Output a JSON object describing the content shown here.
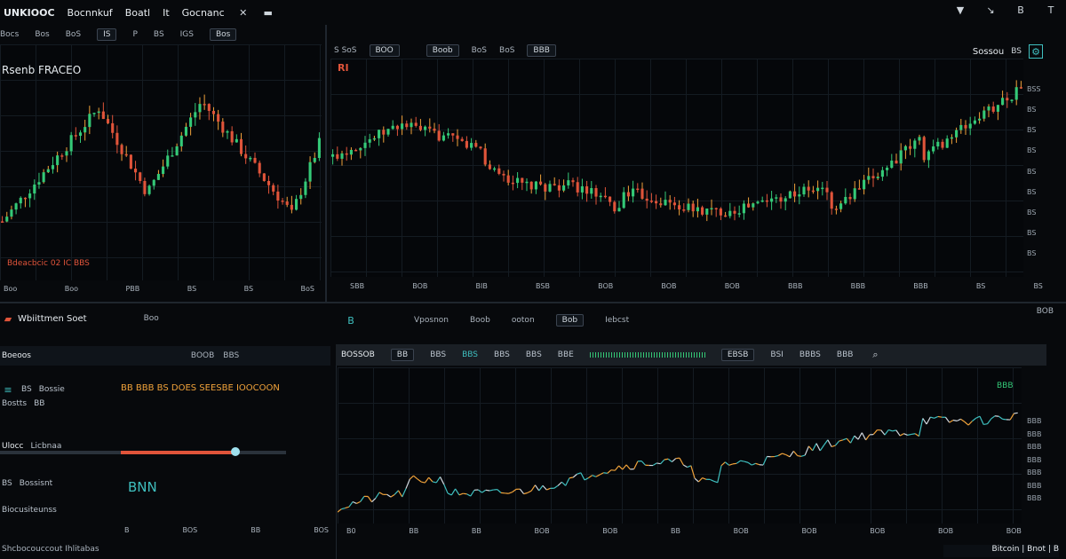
{
  "titlebar": {
    "app_title": "UNKIOOC",
    "menu_items": [
      "Bocnnkuf",
      "Boatl",
      "It",
      "Gocnanc"
    ],
    "window_icons": [
      "play-icon",
      "minimize-icon",
      "cursor-icon",
      "maximize-icon",
      "pin-icon"
    ]
  },
  "left_chart": {
    "toolbar": [
      "Bocs",
      "Bos",
      "BoS",
      "IS",
      "P",
      "BS",
      "IGS",
      "Bos"
    ],
    "title": "Rsenb FRACEO",
    "footer_label": "Bdeacbcic 02 IC BBS",
    "time_axis": [
      "Boo",
      "Boo",
      "PBB",
      "BS",
      "BS",
      "BoS"
    ]
  },
  "main_chart": {
    "toolbar": [
      "S SoS",
      "BOO",
      "Boob",
      "BoS",
      "BoS",
      "BBB"
    ],
    "symbol_badge": "RI",
    "right_label": "Sossou",
    "right_badge": "BS",
    "price_axis": [
      "BSS",
      "BS",
      "BS",
      "BS",
      "BS",
      "BS",
      "BS",
      "BS",
      "BS"
    ],
    "time_axis": [
      "SBB",
      "BOB",
      "BIB",
      "BSB",
      "BOB",
      "BOB",
      "BOB",
      "BBB",
      "BBB",
      "BBB",
      "BS",
      "BS"
    ]
  },
  "middle_bar": {
    "left_title": "Wbiittmen Soet",
    "left_btn": "Boo",
    "tabs": [
      "Vposnon",
      "Boob",
      "ooton",
      "Bob",
      "Iebcst"
    ],
    "right_value": "BOB"
  },
  "data_row": {
    "left": [
      "Boeoos",
      "BOOB",
      "BBS"
    ],
    "cells": [
      "BOSSOB",
      "BB",
      "BBS",
      "BBS",
      "BBS",
      "BBS",
      "BBE",
      "EBSB",
      "BSI",
      "BBBS",
      "BBB"
    ]
  },
  "side_panel": {
    "rows": [
      {
        "a": "BS",
        "b": "Bossie"
      },
      {
        "a": "Bostts",
        "b": "BB"
      },
      {
        "a": "Ulocc",
        "b": "Licbnaa"
      },
      {
        "a": "BS",
        "b": "Bossisnt"
      },
      {
        "a": "Biocusiteunss",
        "b": ""
      }
    ],
    "alert_text": "BB BBB BS DOES SEESBE IOOCOON",
    "chart_hint": "BNN",
    "footer": "Shcbocouccout Ihlitabas",
    "bottom_axis": [
      "B",
      "BOS",
      "BB",
      "BOS"
    ]
  },
  "bottom_chart": {
    "price_axis": [
      "BBB",
      "BBB",
      "BBB",
      "BBB",
      "BBB",
      "BBB",
      "BBB"
    ],
    "right_badge": "BBB",
    "time_axis": [
      "B0",
      "BB",
      "BB",
      "BOB",
      "BOB",
      "BB",
      "BOB",
      "BOB",
      "BOB",
      "BOB",
      "BOB"
    ],
    "status": "Bitcoin | Bnot | B"
  },
  "colors": {
    "up": "#34c977",
    "down": "#e0543a",
    "wick": "#f0a23a",
    "accent_teal": "#3fbfbf"
  }
}
